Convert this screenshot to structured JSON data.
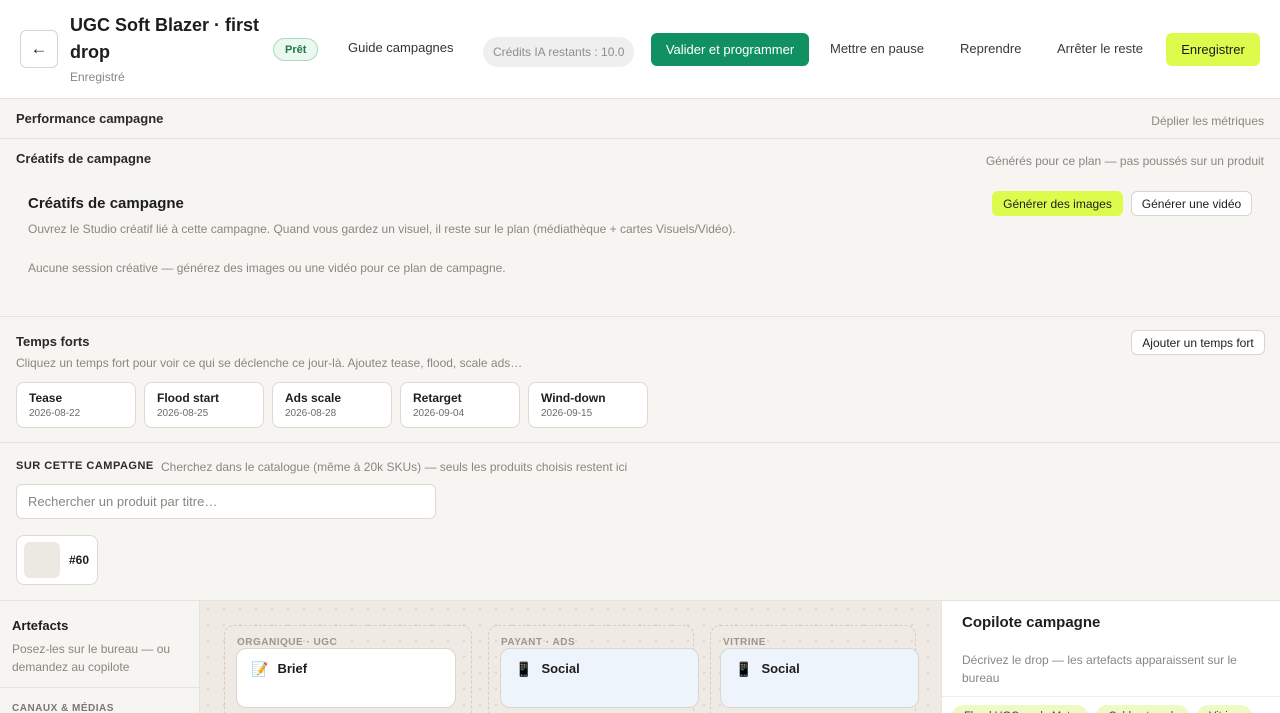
{
  "header": {
    "back_icon": "arrow-left-icon",
    "back_glyph": "←",
    "title": "UGC Soft Blazer · first drop",
    "subtitle": "Enregistré",
    "status_badge": "Prêt",
    "guide_link": "Guide campagnes",
    "credits": "Crédits IA restants : 10.0",
    "validate_button": "Valider et programmer",
    "pause_link": "Mettre en pause",
    "resume_link": "Reprendre",
    "stop_link": "Arrêter le reste",
    "save_button": "Enregistrer",
    "colors": {
      "primary_green": "#119162",
      "accent_lime": "#ddfb4c",
      "badge_green": "#1c7a47"
    }
  },
  "performance": {
    "title": "Performance campagne",
    "expand_link": "Déplier les métriques"
  },
  "creatifs": {
    "section_title": "Créatifs de campagne",
    "section_note": "Générés pour ce plan — pas poussés sur un produit",
    "heading": "Créatifs de campagne",
    "description": "Ouvrez le Studio créatif lié à cette campagne. Quand vous gardez un visuel, il reste sur le plan (médiathèque + cartes Visuels/Vidéo).",
    "empty_state": "Aucune session créative — générez des images ou une vidéo pour ce plan de campagne.",
    "generate_images_button": "Générer des images",
    "generate_video_button": "Générer une vidéo"
  },
  "temps_forts": {
    "title": "Temps forts",
    "description": "Cliquez un temps fort pour voir ce qui se déclenche ce jour-là. Ajoutez tease, flood, scale ads…",
    "add_button": "Ajouter un temps fort",
    "moments": [
      {
        "name": "Tease",
        "date": "2026-08-22"
      },
      {
        "name": "Flood start",
        "date": "2026-08-25"
      },
      {
        "name": "Ads scale",
        "date": "2026-08-28"
      },
      {
        "name": "Retarget",
        "date": "2026-09-04"
      },
      {
        "name": "Wind-down",
        "date": "2026-09-15"
      }
    ]
  },
  "campaign_products": {
    "label": "SUR CETTE CAMPAGNE",
    "hint": "Cherchez dans le catalogue (même à 20k SKUs) — seuls les produits choisis restent ici",
    "search_placeholder": "Rechercher un produit par titre…",
    "products": [
      {
        "id": "#60"
      }
    ]
  },
  "artefacts": {
    "title": "Artefacts",
    "description": "Posez-les sur le bureau — ou demandez au copilote",
    "canaux_label": "CANAUX & MÉDIAS"
  },
  "desk": {
    "lanes": [
      {
        "label": "ORGANIQUE · UGC",
        "card": {
          "icon": "memo-icon",
          "glyph": "📝",
          "label": "Brief"
        }
      },
      {
        "label": "PAYANT · ADS",
        "card": {
          "icon": "phone-icon",
          "glyph": "📱",
          "label": "Social"
        }
      },
      {
        "label": "VITRINE",
        "card": {
          "icon": "phone-icon",
          "glyph": "📱",
          "label": "Social"
        }
      }
    ]
  },
  "copilot": {
    "title": "Copilote campagne",
    "description": "Décrivez le drop — les artefacts apparaissent sur le bureau",
    "suggestions": [
      "Flood UGC sur la Meta",
      "Cold outreach",
      "Vitrine"
    ]
  }
}
